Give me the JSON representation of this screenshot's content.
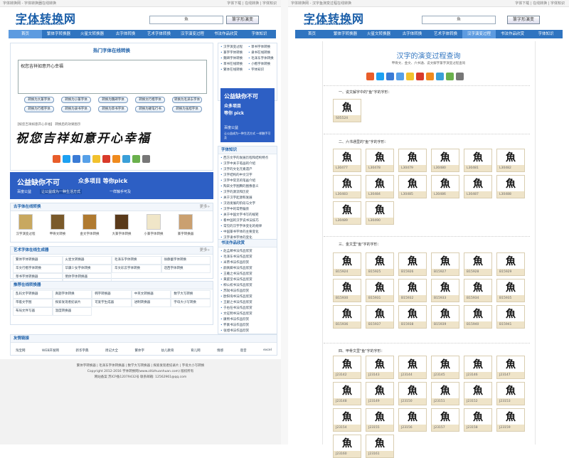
{
  "left": {
    "topbar_left": "字体转换网 - 字体转换器在线转换",
    "topbar_right": "字体下载 | 在线转换 | 字体知识",
    "logo": "字体转换网",
    "logo_sub": "www.zitizhuanhuan.com",
    "search_value": "鱼",
    "search_btn": "篆字形演变",
    "nav": [
      "首页",
      "繁体字转换器",
      "火星文转换器",
      "古字体转换",
      "艺术字体转换",
      "汉字演变过程",
      "书法作品欣赏",
      "字体知识"
    ],
    "nav_active": 0,
    "main_title": "热门字体在线转换",
    "input_text": "祝您吉祥如意开心幸福",
    "btns": [
      "转换为大篆字体",
      "转换为小篆字体",
      "转换为魏碑字体",
      "转换文行楷字体",
      "转换为毛泽东字体",
      "转换为行楷字体",
      "转换为隶书字体",
      "转换为草书字体",
      "转换为硬笔行书",
      "转换为张旭字体"
    ],
    "hint": "【祝您吉祥如意开心幸福】 转换后的效果图示",
    "calligraphy": "祝您吉祥如意开心幸福",
    "ad": {
      "title": "公益缺你不可",
      "sub": "众多项目 等你pick",
      "brand": "百度公益",
      "note": "让公益成为一种生活方式",
      "badge": "一样触手可及"
    },
    "side_links": [
      "汉字演变过程",
      "草书字体转换",
      "篆字字体转换",
      "隶书在线转换",
      "魏碑字体转换",
      "毛泽东字体转换",
      "草书在线转换",
      "小楷字体转换",
      "繁体在线转换",
      "字体知识"
    ],
    "side_ad": {
      "title": "公益缺你不可",
      "sub": "众多项目",
      "pick": "等你 pick",
      "brand": "百度公益",
      "note": "让公益成为一种生活方式 一样触手可及"
    },
    "kn_title": "字体知识",
    "knowledge": [
      "西方文字的发展历程和结构特点",
      "汉字中关于笔画的介绍",
      "汉字的文化元素遗产",
      "汉字结构的中文汉字",
      "汉字中常见的笔画介绍",
      "陶宋文字图腾的图像意义",
      "汉字的源流和历史",
      "关于汉字起源和发展",
      "汉语发展的阶段与文字",
      "汉字中的常用偏旁",
      "关于中国文字书写的规矩",
      "看中国的汉字说书法技巧",
      "常见的汉字字体变化的规律",
      "中国篆书字体的主要变化",
      "汉字隶书字体的变化",
      "汉字形体美与字体的变化"
    ],
    "old_title": "古字体在线转换",
    "old_more": "更多»",
    "old_items": [
      "汉字演变过程",
      "甲骨文转换",
      "金文字体转换",
      "大篆字体转换",
      "小篆字体转换",
      "篆字转换器"
    ],
    "art_title": "艺术字体在线生成器",
    "art_more": "更多»",
    "art_items": [
      "繁体字体转换器",
      "火星文转换器",
      "毛泽东字体转换",
      "徐静蕾字体转换",
      "华文行楷字体转换",
      "华康少女字体转换",
      "华文彩云字体转换",
      "话西字体转换",
      "草书字体转换器",
      "明体字体转换器"
    ],
    "tool_title": "推荐在线转换器",
    "tool_items": [
      "乱码文字转换器",
      "真题字体转换",
      "韩字转换器",
      "中英文转换器",
      "数学大写转换",
      "带着文字图",
      "探索发现者纪录片",
      "可爱字生成器",
      "进制转换器",
      "字母大小写转换",
      "布局文件写器",
      "温度转换器"
    ],
    "calli_title": "书法作品欣赏",
    "calli_items": [
      "赵孟頫书法作品欣赏",
      "毛泽东书法作品欣赏",
      "米芾书法作品欣赏",
      "颜真卿书法作品欣赏",
      "王羲之书法作品欣赏",
      "黄庭坚书法作品欣赏",
      "柳公权书法作品欣赏",
      "苏轼书法作品欣赏",
      "欧阳询书法作品欣赏",
      "王献之书法作品欣赏",
      "于右任书法作品欣赏",
      "文征明书法作品欣赏",
      "康熙书法作品欣赏",
      "怀素书法作品欣赏",
      "张旭书法作品欣赏",
      "文征明书法作品欣赏"
    ],
    "friends_title": "友情链接",
    "friends": [
      "淘宝网",
      "WEB开发网",
      "新华字典",
      "周记大全",
      "繁体字",
      "幼儿教育",
      "育儿网",
      "情感",
      "谐音",
      "excel"
    ],
    "footer1": "繁体字转换器 | 毛泽东字体转换器 | 数学大写转换器 | 探索发现者纪录片 | 字母大小写转换",
    "footer2": "Copyright 2012-2016 字体转换网(www.zitizhuanhuan.com) 版权所有",
    "footer3": "网站备案 苏ICP备12079432号 联系邮箱: 12562961@qq.com"
  },
  "right": {
    "topbar_left": "字体转换网 - 汉字鱼演变过程在线转换",
    "topbar_right": "字体下载 | 在线转换 | 字体知识",
    "logo": "字体转换网",
    "logo_sub": "www.zitizhuanhuan.com",
    "search_value": "鱼",
    "search_btn": "篆字形演变",
    "nav": [
      "首页",
      "繁体字转换器",
      "火星文转换器",
      "古字体转换",
      "艺术字体转换",
      "汉字演变过程",
      "书法作品欣赏",
      "字体知识"
    ],
    "nav_active": 5,
    "title": "汉字的演变过程查询",
    "sub": "甲骨文、金文、六书通、说文解字篆字演变过程查询",
    "s1": "一、说文解字中的\"鱼\"字的字形：",
    "s1_items": [
      {
        "g": "魚",
        "c": "S05524"
      }
    ],
    "s2": "二、六书通里的\"鱼\"字的字形：",
    "s2_items": [
      {
        "g": "魚",
        "c": "L30477"
      },
      {
        "g": "魚",
        "c": "L30478"
      },
      {
        "g": "魚",
        "c": "L30479"
      },
      {
        "g": "魚",
        "c": "L30480"
      },
      {
        "g": "魚",
        "c": "L30481"
      },
      {
        "g": "魚",
        "c": "L30482"
      },
      {
        "g": "魚",
        "c": "L30483"
      },
      {
        "g": "魚",
        "c": "L30484"
      },
      {
        "g": "魚",
        "c": "L30485"
      },
      {
        "g": "魚",
        "c": "L30486"
      },
      {
        "g": "魚",
        "c": "L30487"
      },
      {
        "g": "魚",
        "c": "L30488"
      },
      {
        "g": "魚",
        "c": "L30489"
      },
      {
        "g": "魚",
        "c": "L30490"
      }
    ],
    "s3": "三、金文里\"鱼\"字的字形：",
    "s3_items": [
      {
        "g": "魚",
        "c": "B15924"
      },
      {
        "g": "魚",
        "c": "B15925"
      },
      {
        "g": "魚",
        "c": "B15926"
      },
      {
        "g": "魚",
        "c": "B15927"
      },
      {
        "g": "魚",
        "c": "B15928"
      },
      {
        "g": "魚",
        "c": "B15929"
      },
      {
        "g": "魚",
        "c": "B15930"
      },
      {
        "g": "魚",
        "c": "B15931"
      },
      {
        "g": "魚",
        "c": "B15932"
      },
      {
        "g": "魚",
        "c": "B15933"
      },
      {
        "g": "魚",
        "c": "B15934"
      },
      {
        "g": "魚",
        "c": "B15935"
      },
      {
        "g": "魚",
        "c": "B15936"
      },
      {
        "g": "魚",
        "c": "B15937"
      },
      {
        "g": "魚",
        "c": "B15938"
      },
      {
        "g": "魚",
        "c": "B15939"
      },
      {
        "g": "魚",
        "c": "B15940"
      },
      {
        "g": "魚",
        "c": "B15941"
      }
    ],
    "s4": "四、甲骨文里\"鱼\"字的字形：",
    "s4_items": [
      {
        "g": "魚",
        "c": "J23142"
      },
      {
        "g": "魚",
        "c": "J23143"
      },
      {
        "g": "魚",
        "c": "J23144"
      },
      {
        "g": "魚",
        "c": "J23145"
      },
      {
        "g": "魚",
        "c": "J23146"
      },
      {
        "g": "魚",
        "c": "J23147"
      },
      {
        "g": "魚",
        "c": "J23148"
      },
      {
        "g": "魚",
        "c": "J23149"
      },
      {
        "g": "魚",
        "c": "J23150"
      },
      {
        "g": "魚",
        "c": "J23151"
      },
      {
        "g": "魚",
        "c": "J23152"
      },
      {
        "g": "魚",
        "c": "J23153"
      },
      {
        "g": "魚",
        "c": "J23154"
      },
      {
        "g": "魚",
        "c": "J23155"
      },
      {
        "g": "魚",
        "c": "J23156"
      },
      {
        "g": "魚",
        "c": "J23157"
      },
      {
        "g": "魚",
        "c": "J23158"
      },
      {
        "g": "魚",
        "c": "J23159"
      },
      {
        "g": "魚",
        "c": "J23160"
      },
      {
        "g": "魚",
        "c": "J23161"
      }
    ]
  },
  "share_colors": [
    "#e85d2a",
    "#1da1f2",
    "#3a7bd5",
    "#56a0e8",
    "#f2c12e",
    "#d93a2a",
    "#ef8a1e",
    "#3a9fd8",
    "#6ab04c",
    "#777777"
  ]
}
